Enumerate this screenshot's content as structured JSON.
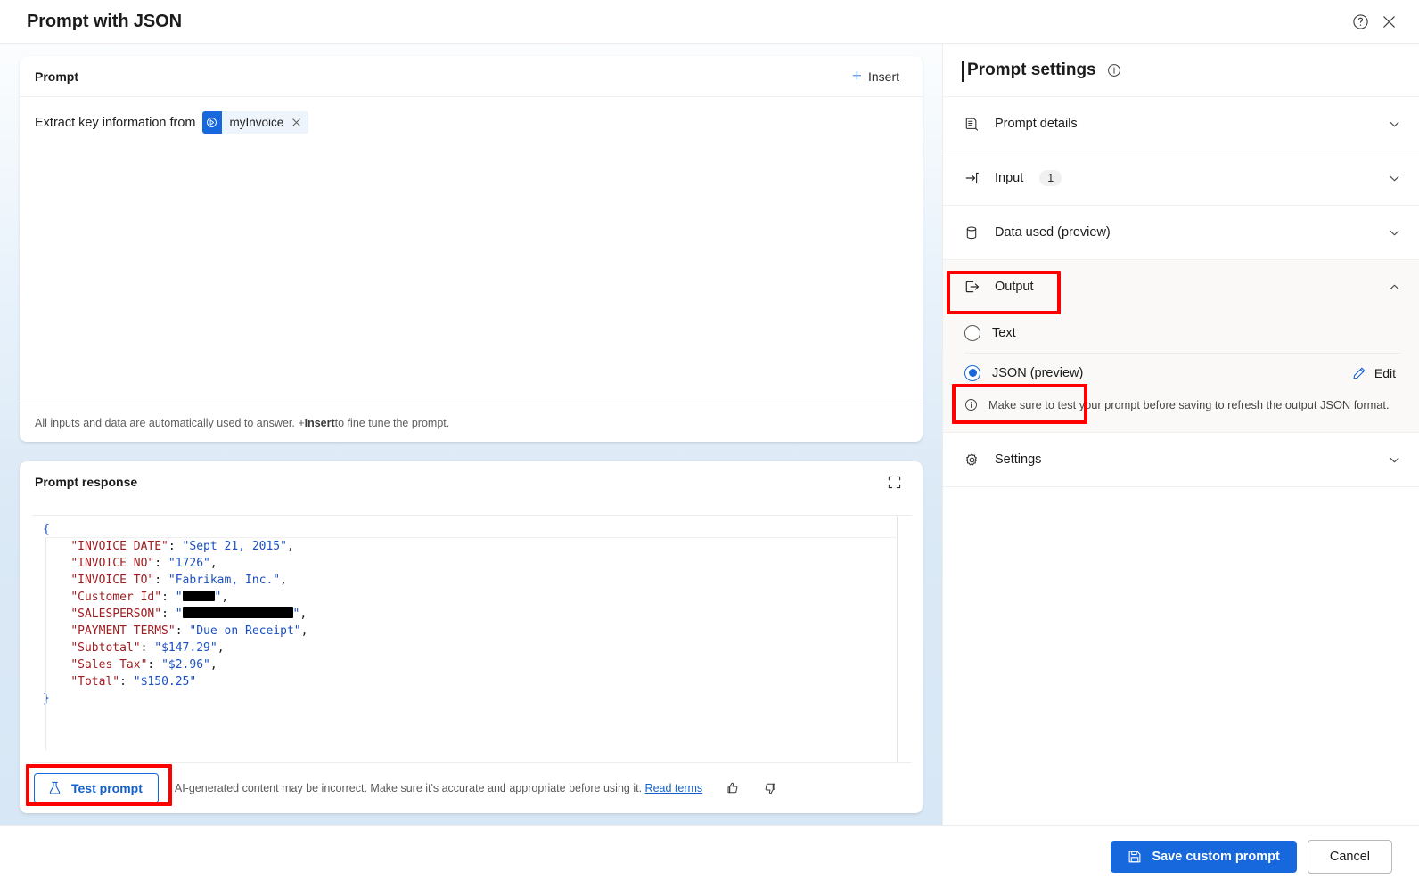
{
  "window": {
    "title": "Prompt with JSON",
    "help_icon": "help-circle-icon",
    "close_icon": "close-icon"
  },
  "prompt_card": {
    "heading": "Prompt",
    "insert_label": "Insert",
    "insert_icon": "plus-icon",
    "text_before_chip": "Extract key information from",
    "chip": {
      "label": "myInvoice",
      "icon": "power-platform-icon",
      "close_icon": "close-icon",
      "icon_bg": "#1668dc",
      "chip_bg": "#eef4fc"
    },
    "footer_note_part1": "All inputs and data are automatically used to answer. + ",
    "footer_note_bold": "Insert",
    "footer_note_part2": " to fine tune the prompt."
  },
  "response_card": {
    "heading": "Prompt response",
    "expand_icon": "expand-icon",
    "code": {
      "language": "json",
      "open_brace": "{",
      "close_brace": "}",
      "entries": [
        {
          "key": "INVOICE DATE",
          "value": "Sept 21, 2015",
          "redacted": false,
          "comma": true
        },
        {
          "key": "INVOICE NO",
          "value": "1726",
          "redacted": false,
          "comma": true
        },
        {
          "key": "INVOICE TO",
          "value": "Fabrikam, Inc.",
          "redacted": false,
          "comma": true
        },
        {
          "key": "Customer Id",
          "value": "",
          "redacted": true,
          "redact_width": 36,
          "comma": true
        },
        {
          "key": "SALESPERSON",
          "value": "",
          "redacted": true,
          "redact_width": 124,
          "comma": true
        },
        {
          "key": "PAYMENT TERMS",
          "value": "Due on Receipt",
          "redacted": false,
          "comma": true
        },
        {
          "key": "Subtotal",
          "value": "$147.29",
          "redacted": false,
          "comma": true
        },
        {
          "key": "Sales Tax",
          "value": "$2.96",
          "redacted": false,
          "comma": true
        },
        {
          "key": "Total",
          "value": "$150.25",
          "redacted": false,
          "comma": false
        }
      ],
      "colors": {
        "key": "#a11d21",
        "string": "#1a4fc4",
        "brace": "#1652cf"
      }
    },
    "test_prompt_label": "Test prompt",
    "test_prompt_icon": "beaker-icon",
    "disclaimer": "AI-generated content may be incorrect. Make sure it's accurate and appropriate before using it.",
    "read_terms_label": "Read terms",
    "thumbs_up_icon": "thumbs-up-icon",
    "thumbs_down_icon": "thumbs-down-icon"
  },
  "settings_panel": {
    "title": "Prompt settings",
    "info_icon": "info-circle-icon",
    "sections": [
      {
        "label": "Prompt details",
        "icon": "document-icon",
        "expanded": false,
        "badge": null
      },
      {
        "label": "Input",
        "icon": "arrow-in-icon",
        "expanded": false,
        "badge": "1"
      },
      {
        "label": "Data used (preview)",
        "icon": "database-icon",
        "expanded": false,
        "badge": null
      },
      {
        "label": "Output",
        "icon": "arrow-out-icon",
        "expanded": true,
        "badge": null
      },
      {
        "label": "Settings",
        "icon": "gear-icon",
        "expanded": false,
        "badge": null
      }
    ],
    "output": {
      "options": [
        {
          "label": "Text",
          "selected": false
        },
        {
          "label": "JSON (preview)",
          "selected": true
        }
      ],
      "edit_label": "Edit",
      "edit_icon": "pencil-icon",
      "note": "Make sure to test your prompt before saving to refresh the output JSON format.",
      "note_icon": "info-circle-icon"
    }
  },
  "footer": {
    "save_label": "Save custom prompt",
    "save_icon": "save-icon",
    "cancel_label": "Cancel",
    "accent_color": "#1668dc"
  },
  "annotations": {
    "highlight_color": "#fd0100",
    "targets": [
      "Output",
      "JSON (preview)",
      "Test prompt"
    ]
  }
}
